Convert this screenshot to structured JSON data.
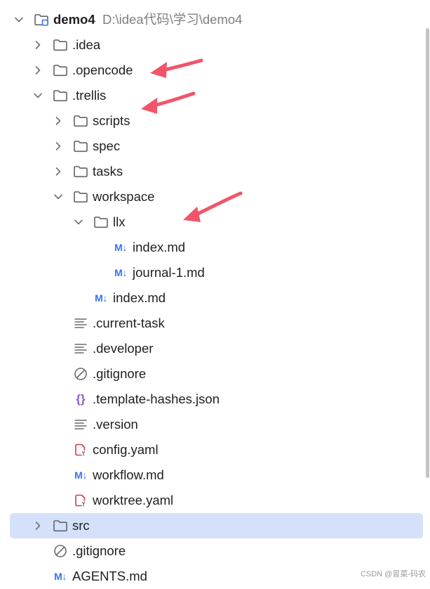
{
  "tree": {
    "root": {
      "name": "demo4",
      "path": "D:\\idea代码\\学习\\demo4"
    },
    "items": [
      {
        "id": "idea",
        "label": ".idea"
      },
      {
        "id": "opencode",
        "label": ".opencode"
      },
      {
        "id": "trellis",
        "label": ".trellis"
      },
      {
        "id": "scripts",
        "label": "scripts"
      },
      {
        "id": "spec",
        "label": "spec"
      },
      {
        "id": "tasks",
        "label": "tasks"
      },
      {
        "id": "workspace",
        "label": "workspace"
      },
      {
        "id": "llx",
        "label": "llx"
      },
      {
        "id": "llx-index",
        "label": "index.md"
      },
      {
        "id": "llx-journal",
        "label": "journal-1.md"
      },
      {
        "id": "workspace-index",
        "label": "index.md"
      },
      {
        "id": "current-task",
        "label": ".current-task"
      },
      {
        "id": "developer",
        "label": ".developer"
      },
      {
        "id": "gitignore-trellis",
        "label": ".gitignore"
      },
      {
        "id": "template-hashes",
        "label": ".template-hashes.json"
      },
      {
        "id": "version",
        "label": ".version"
      },
      {
        "id": "config",
        "label": "config.yaml"
      },
      {
        "id": "workflow",
        "label": "workflow.md"
      },
      {
        "id": "worktree",
        "label": "worktree.yaml"
      },
      {
        "id": "src",
        "label": "src"
      },
      {
        "id": "gitignore-root",
        "label": ".gitignore"
      },
      {
        "id": "agents",
        "label": "AGENTS.md"
      }
    ]
  },
  "icons": {
    "markdown_glyph": "M↓",
    "json_glyph": "{}"
  },
  "colors": {
    "selection": "#d5e1fb",
    "annotation_arrow": "#f0556a",
    "markdown_icon": "#3574f0",
    "json_icon": "#8c5ad6",
    "yaml_icon": "#d13a4f"
  },
  "watermark": "CSDN @冒菜-码农"
}
